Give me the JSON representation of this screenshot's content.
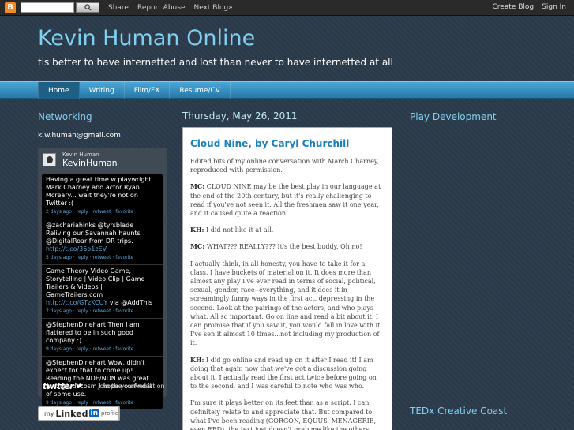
{
  "navbar": {
    "logo_glyph": "B",
    "search_button_icon": "magnifier-icon",
    "links": [
      "Share",
      "Report Abuse",
      "Next Blog»"
    ],
    "right_links": [
      "Create Blog",
      "Sign In"
    ]
  },
  "header": {
    "title": "Kevin Human Online",
    "description": "tis better to have internetted and lost than never to have internetted at all"
  },
  "tabs": [
    "Home",
    "Writing",
    "Film/FX",
    "Resume/CV"
  ],
  "left": {
    "heading": "Networking",
    "email": "k.w.human@gmail.com",
    "twitter": {
      "display_name": "Kevin Human",
      "handle": "KevinHuman",
      "tweets": [
        {
          "text": "Having a great time w playwright Mark Charney and actor Ryan Mcreary... wait they're not on Twitter :(",
          "meta": "2 days ago · reply · retweet · favorite"
        },
        {
          "pre": "@zachariahinks @tyrsblade Reliving our Savannah haunts @DigitalRoar from DR trips. ",
          "link": "http://t.co/36o1zEV",
          "meta": "5 days ago · reply · retweet · favorite"
        },
        {
          "pre": "Game Theory Video Game, Storytelling | Video Clip | Game Trailers & Videos | GameTrailers.com ",
          "link": "http://t.co/GTzKCUY",
          "post": " via @AddThis",
          "meta": "7 days ago · reply · retweet · favorite"
        },
        {
          "pre": "@StephenDinehart Then I am flattered to be in such good company :)",
          "meta": "9 days ago · reply · retweet · favorite"
        },
        {
          "pre": "@StephenDinehart Wow, didn't expect for that to come up! Reading the NDE/NDN was great fun. @ludocosm I hope you find it of some use.",
          "meta": "9 days ago · reply · retweet · favorite"
        }
      ],
      "footer_logo": "twitter",
      "join": "Join the conversation"
    },
    "linkedin": {
      "my": "my",
      "linked": "Linked",
      "in": "in",
      "profile": "profile"
    }
  },
  "post": {
    "date": "Thursday, May 26, 2011",
    "title": "Cloud Nine, by Caryl Churchill",
    "paragraphs": [
      {
        "speaker": "",
        "text": "Edited bits of my online conversation with March Charney, reproduced with permission."
      },
      {
        "speaker": "MC:",
        "text": " CLOUD NINE may be the best play in our language at the end of the 20th century, but it's really challenging to read if you've not seen it. All the freshmen saw it one year, and it caused quite a reaction."
      },
      {
        "speaker": "KH:",
        "text": " I did not like it at all."
      },
      {
        "speaker": "MC:",
        "text": " WHAT??? REALLY??? It's the best buddy. Oh no!"
      },
      {
        "speaker": "",
        "text": "I actually think, in all honesty, you have to take it for a class. I have buckets of material on it. It does more than almost any play I've ever read in terms of social, political, sexual, gender, race--everything, and it does it in screamingly funny ways in the first act, depressing in the second. Look at the pairings of the actors, and who plays what. All so important. Go on line and read a bit about it. I can promise that if you saw it, you would fall in love with it. I've sen it almost 10 times...not including my production of it."
      },
      {
        "speaker": "KH:",
        "text": " I did go online and read up on it after I read it! I am doing that again now that we've got a discussion going about it. I actually read the first act twice before going on to the second, and I was careful to note who was who."
      },
      {
        "speaker": "",
        "text": "I'm sure it plays better on its feet than as a script. I can definitely relate to and appreciate that. But compared to what I've been reading (GORGON, EQUUS, MENAGERIE, even RED), the text just doesn't grab me like the others."
      }
    ]
  },
  "right": {
    "heading1": "Play Development",
    "heading2": "TEDx Creative Coast"
  }
}
